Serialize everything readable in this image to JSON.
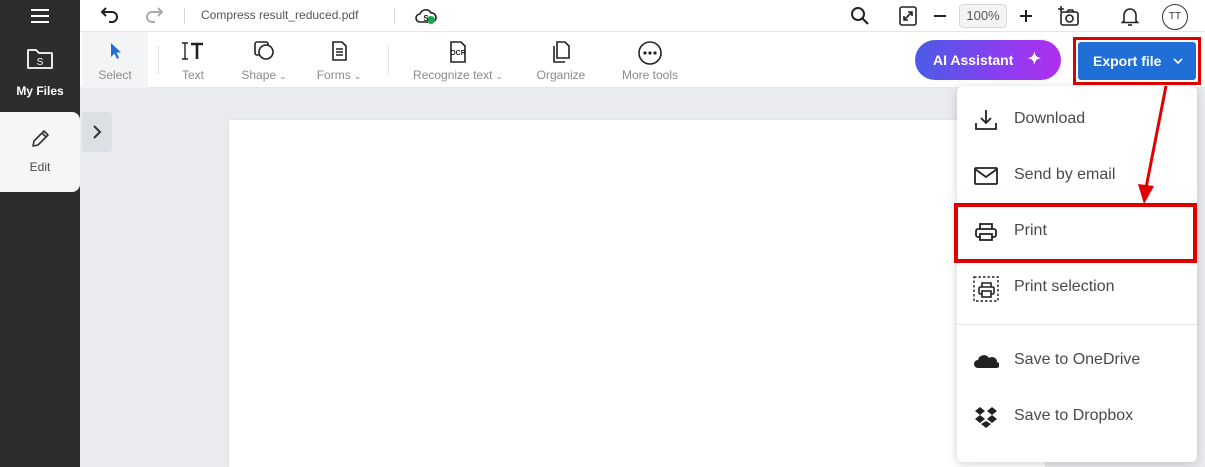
{
  "rail": {
    "my_files_label": "My Files",
    "my_files_icon_letter": "S",
    "edit_label": "Edit"
  },
  "topbar": {
    "filename": "Compress result_reduced.pdf",
    "cloud_badge": "S",
    "zoom": "100%",
    "avatar": "TT"
  },
  "toolbar": {
    "tools": [
      {
        "label": "Select",
        "icon": "cursor-icon",
        "dropdown": false
      },
      {
        "label": "Text",
        "icon": "text-icon",
        "dropdown": false
      },
      {
        "label": "Shape",
        "icon": "shape-icon",
        "dropdown": true
      },
      {
        "label": "Forms",
        "icon": "forms-icon",
        "dropdown": true
      },
      {
        "label": "Recognize text",
        "icon": "ocr-icon",
        "dropdown": true
      },
      {
        "label": "Organize",
        "icon": "organize-icon",
        "dropdown": false
      },
      {
        "label": "More tools",
        "icon": "more-icon",
        "dropdown": false
      }
    ],
    "ocr_icon_text": "OCR",
    "ai_assistant_label": "AI Assistant",
    "export_label": "Export file"
  },
  "export_menu": {
    "items": [
      {
        "label": "Download",
        "icon": "download-icon"
      },
      {
        "label": "Send by email",
        "icon": "email-icon"
      },
      {
        "label": "Print",
        "icon": "printer-icon"
      },
      {
        "label": "Print selection",
        "icon": "print-selection-icon"
      },
      {
        "label": "Save to OneDrive",
        "icon": "onedrive-icon"
      },
      {
        "label": "Save to Dropbox",
        "icon": "dropbox-icon"
      }
    ]
  },
  "colors": {
    "accent_blue": "#1f6fd6",
    "highlight_red": "#e00000",
    "rail_dark": "#2d2d2d",
    "ai_gradient_start": "#4b5ce6",
    "ai_gradient_end": "#b02ff0"
  }
}
